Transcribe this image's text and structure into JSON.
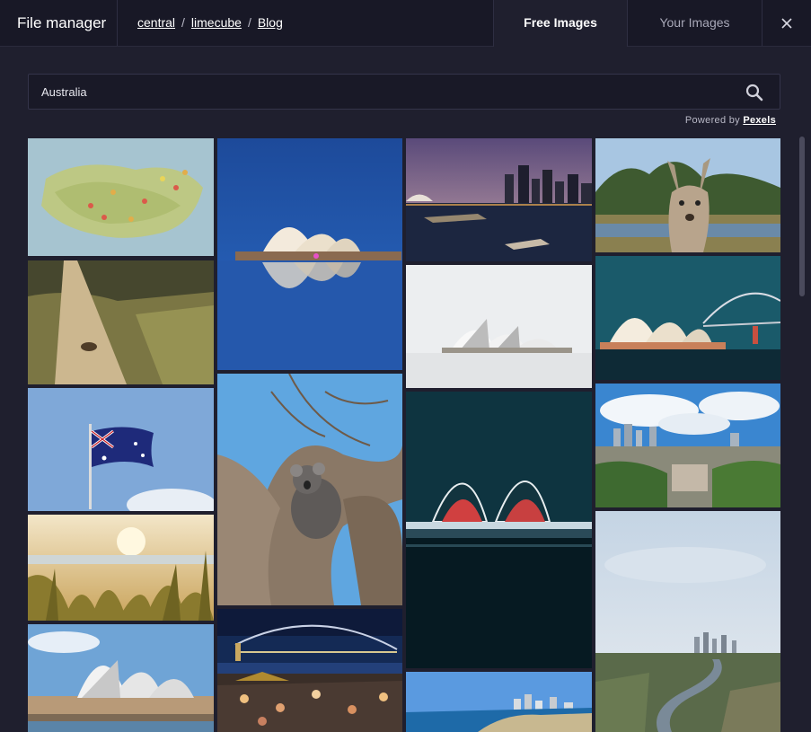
{
  "header": {
    "app_title": "File manager",
    "breadcrumb": [
      "central",
      "limecube",
      "Blog"
    ],
    "breadcrumb_separator": "/",
    "tabs": [
      {
        "label": "Free Images",
        "active": true
      },
      {
        "label": "Your Images",
        "active": false
      }
    ],
    "close_icon": "close-icon"
  },
  "search": {
    "value": "Australia",
    "search_icon": "search-icon"
  },
  "attribution": {
    "prefix": "Powered by",
    "link": "Pexels"
  },
  "images": [
    {
      "subject": "map-of-australia-with-pins"
    },
    {
      "subject": "kangaroo-on-dirt-road"
    },
    {
      "subject": "australian-flag"
    },
    {
      "subject": "beach-grass-at-sunset"
    },
    {
      "subject": "sydney-opera-house-daytime"
    },
    {
      "subject": "opera-house-reflection-blue-hour"
    },
    {
      "subject": "koala-in-tree"
    },
    {
      "subject": "harbour-bridge-night-crowd"
    },
    {
      "subject": "sydney-skyline-dusk"
    },
    {
      "subject": "opera-house-in-fog"
    },
    {
      "subject": "opera-house-at-night"
    },
    {
      "subject": "coastal-city-beach"
    },
    {
      "subject": "kangaroo-portrait"
    },
    {
      "subject": "opera-house-and-harbour-bridge"
    },
    {
      "subject": "city-skyline-with-clouds"
    },
    {
      "subject": "aerial-city-river"
    }
  ],
  "colors": {
    "background": "#1f1f2e",
    "header": "#181826",
    "accent_text": "#ffffff"
  }
}
